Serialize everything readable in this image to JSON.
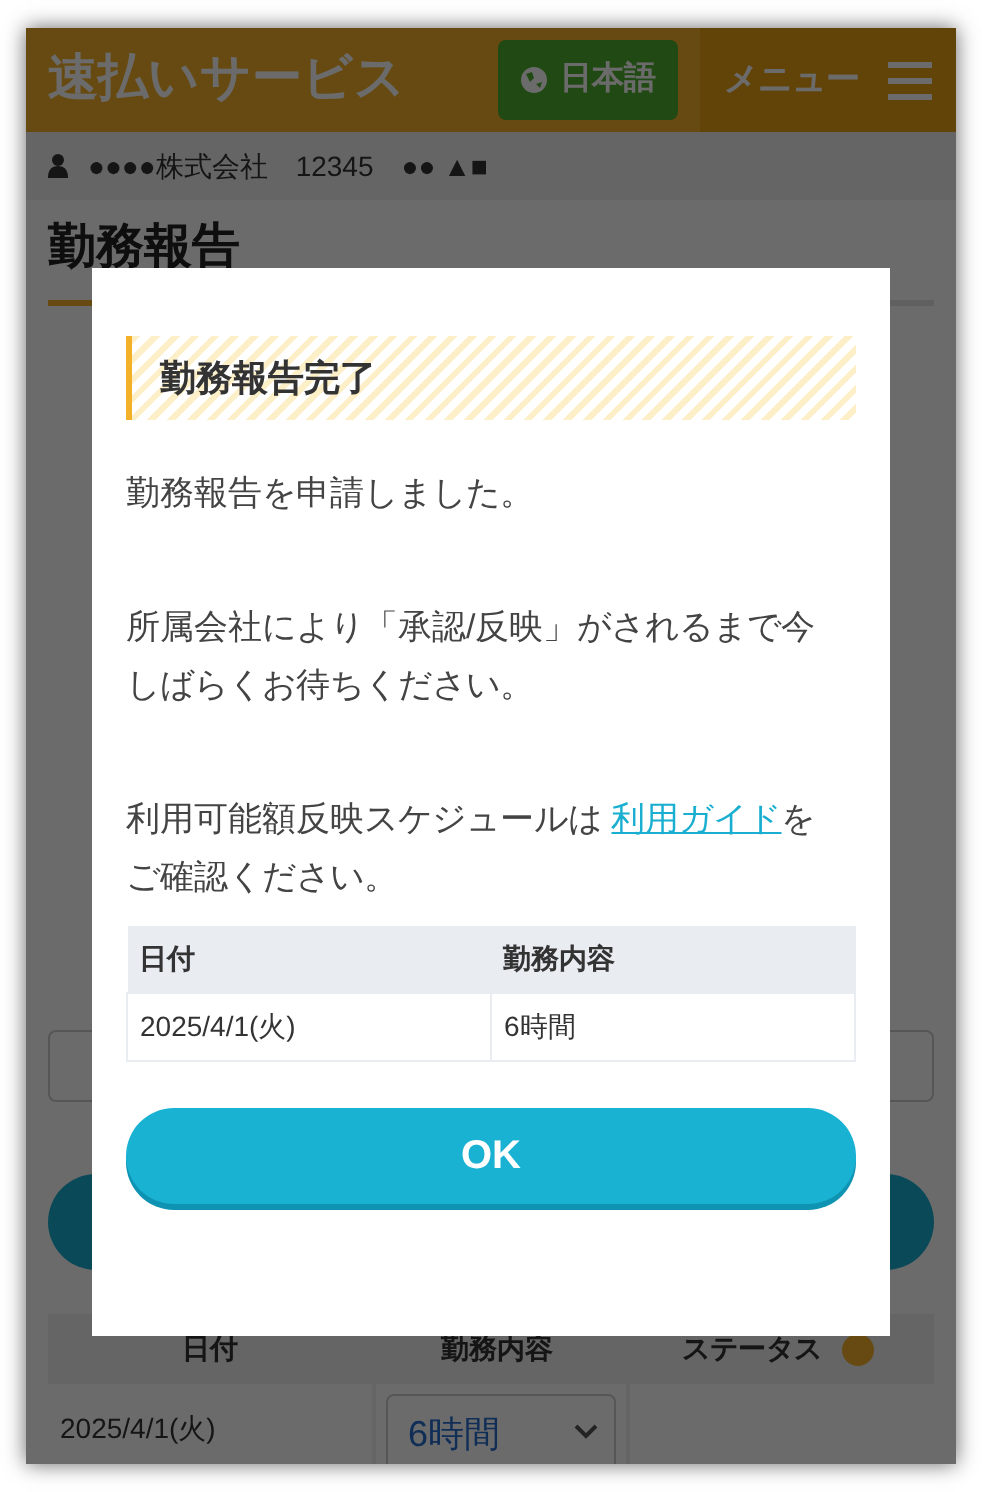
{
  "header": {
    "title": "速払いサービス",
    "language_button": "日本語",
    "menu_label": "メニュー"
  },
  "user_bar": {
    "company": "●●●●株式会社",
    "code": "12345",
    "name": "●● ▲■"
  },
  "page_title": "勤務報告",
  "work_table": {
    "columns": [
      "日付",
      "勤務内容",
      "ステータス"
    ],
    "rows": [
      {
        "date": "2025/4/1(火)",
        "hours": "6時間"
      }
    ]
  },
  "dialog": {
    "title": "勤務報告完了",
    "paragraphs": [
      "勤務報告を申請しました。",
      "所属会社により「承認/反映」がされるまで今しばらくお待ちください。"
    ],
    "guide_note": {
      "before": "利用可能額反映スケジュールは",
      "link": "利用ガイド",
      "after": "をご確認ください。"
    },
    "table": {
      "columns": [
        "日付",
        "勤務内容"
      ],
      "rows": [
        [
          "2025/4/1(火)",
          "6時間"
        ]
      ]
    },
    "ok_button": "OK"
  }
}
